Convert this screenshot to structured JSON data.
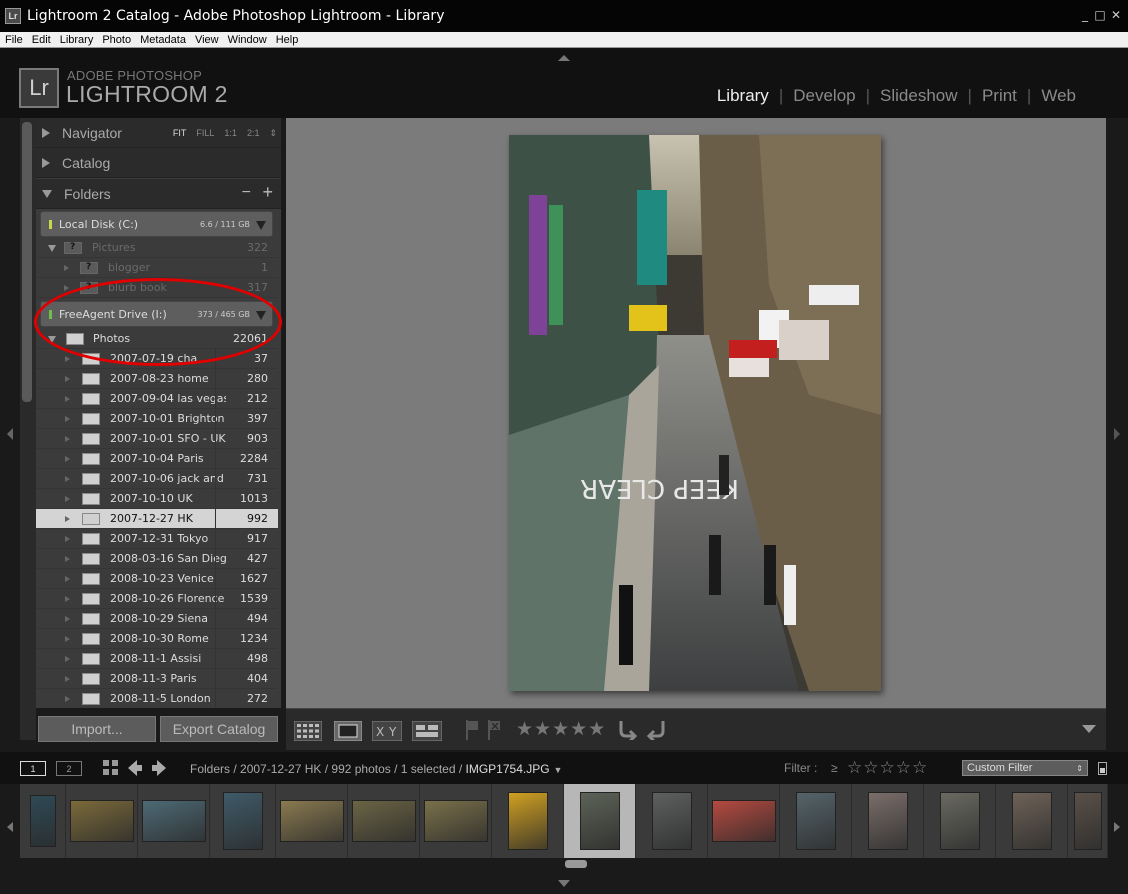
{
  "window": {
    "title": "Lightroom 2 Catalog - Adobe Photoshop Lightroom - Library",
    "app_icon": "Lr"
  },
  "menu": [
    "File",
    "Edit",
    "Library",
    "Photo",
    "Metadata",
    "View",
    "Window",
    "Help"
  ],
  "brand": {
    "logo": "Lr",
    "line1": "ADOBE PHOTOSHOP",
    "line2": "LIGHTROOM 2"
  },
  "modules": [
    {
      "label": "Library",
      "active": true
    },
    {
      "label": "Develop",
      "active": false
    },
    {
      "label": "Slideshow",
      "active": false
    },
    {
      "label": "Print",
      "active": false
    },
    {
      "label": "Web",
      "active": false
    }
  ],
  "navigator": {
    "title": "Navigator",
    "options": [
      "FIT",
      "FILL",
      "1:1",
      "2:1"
    ],
    "selected": "FIT"
  },
  "catalog": {
    "title": "Catalog"
  },
  "folders": {
    "title": "Folders",
    "add": "+",
    "remove": "−",
    "volumes": [
      {
        "name": "Local Disk (C:)",
        "capacity": "6.6 / 111 GB"
      },
      {
        "name": "FreeAgent Drive (I:)",
        "capacity": "373 / 465 GB"
      }
    ],
    "local_items": [
      {
        "name": "Pictures",
        "count": "322"
      },
      {
        "name": "blogger",
        "count": "1"
      },
      {
        "name": "blurb book",
        "count": "317"
      }
    ],
    "root": {
      "name": "Photos",
      "count": "22061"
    },
    "items": [
      {
        "name": "2007-07-19 cha",
        "count": "37"
      },
      {
        "name": "2007-08-23 home",
        "count": "280"
      },
      {
        "name": "2007-09-04 las vegas",
        "count": "212"
      },
      {
        "name": "2007-10-01 Brighton",
        "count": "397"
      },
      {
        "name": "2007-10-01 SFO - UK",
        "count": "903"
      },
      {
        "name": "2007-10-04 Paris",
        "count": "2284"
      },
      {
        "name": "2007-10-06 jack and ...",
        "count": "731"
      },
      {
        "name": "2007-10-10 UK",
        "count": "1013"
      },
      {
        "name": "2007-12-27 HK",
        "count": "992",
        "selected": true
      },
      {
        "name": "2007-12-31 Tokyo",
        "count": "917"
      },
      {
        "name": "2008-03-16 San Diego",
        "count": "427"
      },
      {
        "name": "2008-10-23 Venice",
        "count": "1627"
      },
      {
        "name": "2008-10-26 Florence",
        "count": "1539"
      },
      {
        "name": "2008-10-29 Siena",
        "count": "494"
      },
      {
        "name": "2008-10-30 Rome",
        "count": "1234"
      },
      {
        "name": "2008-11-1 Assisi",
        "count": "498"
      },
      {
        "name": "2008-11-3 Paris",
        "count": "404"
      },
      {
        "name": "2008-11-5 London",
        "count": "272"
      }
    ]
  },
  "buttons": {
    "import": "Import...",
    "export": "Export Catalog"
  },
  "toolbar": {
    "rating": "★★★★★"
  },
  "filmbar": {
    "monitor1": "1",
    "monitor2": "2",
    "path": "Folders / 2007-12-27 HK / 992 photos / 1 selected / ",
    "filename": "IMGP1754.JPG",
    "filter_label": "Filter :",
    "filter_op": "≥",
    "filter_stars": "☆☆☆☆☆",
    "filter_preset": "Custom Filter"
  },
  "colors": {
    "accent": "#e00000",
    "panel": "#3b3b3b",
    "viewer": "#7b7b7b",
    "selected_row": "#d4d4d4"
  }
}
